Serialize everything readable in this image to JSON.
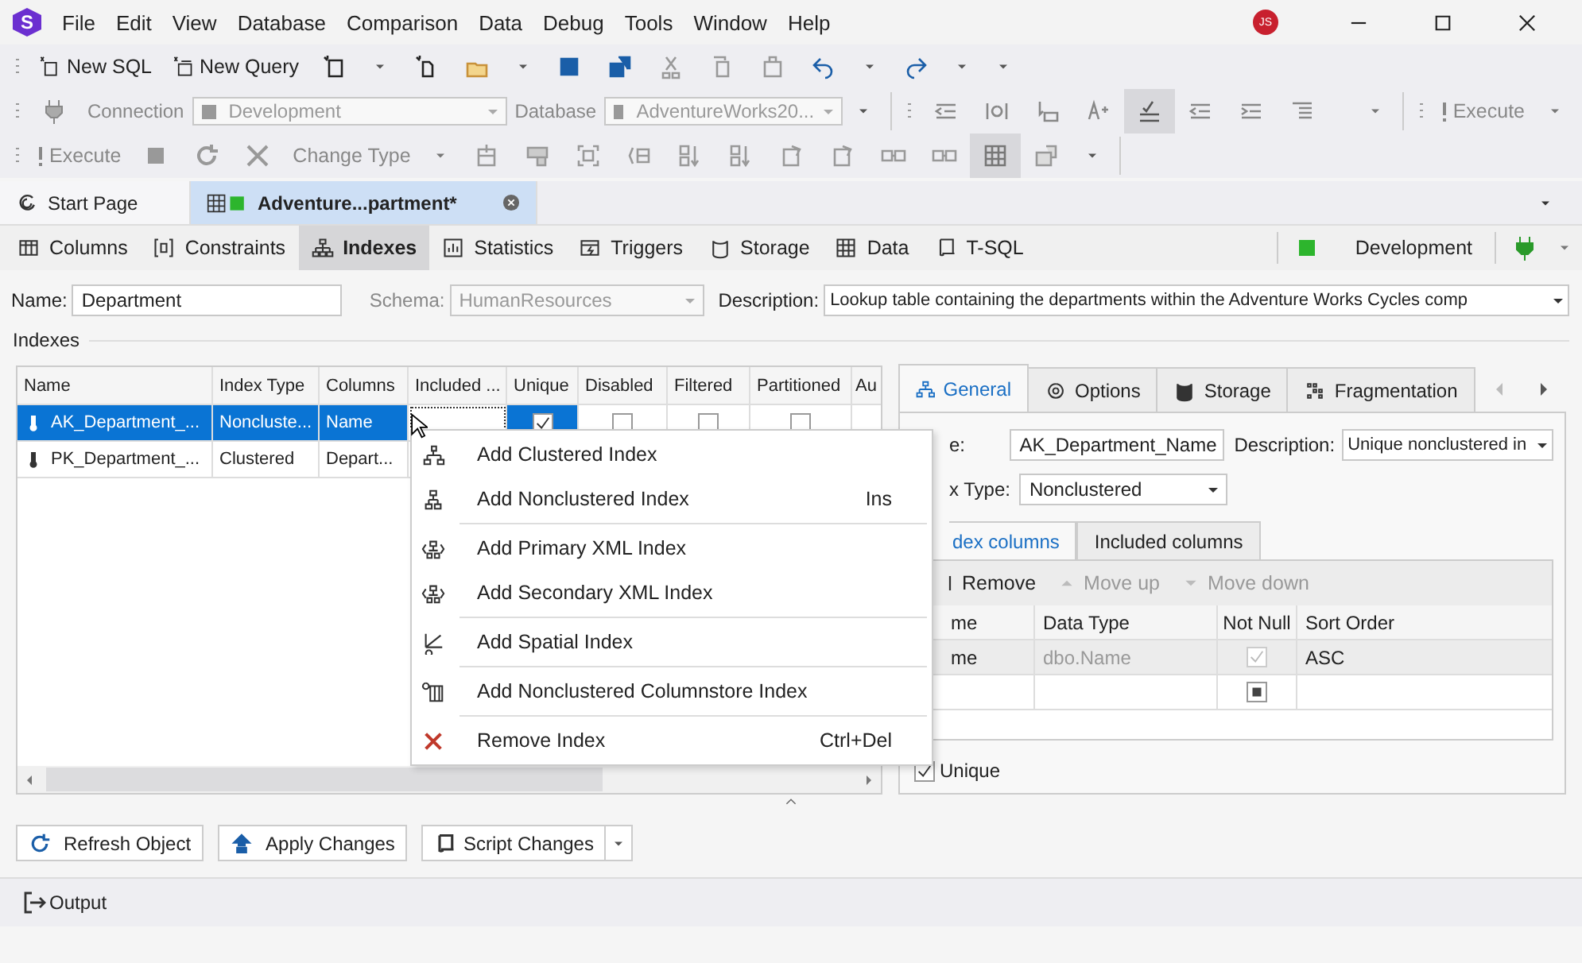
{
  "title_bar": {
    "logo": "S",
    "menu": [
      "File",
      "Edit",
      "View",
      "Database",
      "Comparison",
      "Data",
      "Debug",
      "Tools",
      "Window",
      "Help"
    ],
    "avatar": "JS"
  },
  "toolbar_main": {
    "new_sql": "New SQL",
    "new_query": "New Query"
  },
  "toolbar_connection": {
    "connection_label": "Connection",
    "connection": {
      "value": "Development",
      "disabled": true
    },
    "database_label": "Database",
    "database": {
      "value": "AdventureWorks20...",
      "disabled": true
    },
    "sql_toggle": {
      "on": true
    },
    "execute": {
      "label": "Execute",
      "disabled": true
    }
  },
  "toolbar_edit": {
    "execute": {
      "label": "Execute",
      "disabled": true
    },
    "change_type": {
      "label": "Change Type",
      "disabled": true
    },
    "grid_toggle": {
      "on": true
    }
  },
  "document_tabs": [
    {
      "kind": "start",
      "label": "Start Page",
      "selected": false
    },
    {
      "kind": "table",
      "label": "Adventure...partment*",
      "selected": true
    }
  ],
  "editor_tabs": [
    {
      "kind": "columns",
      "label": "Columns",
      "selected": false
    },
    {
      "kind": "constraints",
      "label": "Constraints",
      "selected": false
    },
    {
      "kind": "indexes",
      "label": "Indexes",
      "selected": true
    },
    {
      "kind": "statistics",
      "label": "Statistics",
      "selected": false
    },
    {
      "kind": "triggers",
      "label": "Triggers",
      "selected": false
    },
    {
      "kind": "storage",
      "label": "Storage",
      "selected": false
    },
    {
      "kind": "data",
      "label": "Data",
      "selected": false
    },
    {
      "kind": "tsql",
      "label": "T-SQL",
      "selected": false
    }
  ],
  "connection_status": {
    "label": "Development"
  },
  "properties": {
    "name_label": "Name:",
    "name": "Department",
    "schema_label": "Schema:",
    "schema": {
      "value": "HumanResources",
      "disabled": true
    },
    "description_label": "Description:",
    "description": "Lookup table containing the departments within the Adventure Works Cycles comp"
  },
  "indexes": {
    "title": "Indexes",
    "columns": [
      "Name",
      "Index Type",
      "Columns",
      "Included ...",
      "Unique",
      "Disabled",
      "Filtered",
      "Partitioned",
      "Au"
    ],
    "rows": [
      {
        "selected": true,
        "name": "AK_Department_...",
        "index_type": "Noncluste...",
        "columns": "Name",
        "flags": [
          {
            "checked": true
          },
          {
            "checked": false
          },
          {
            "checked": false
          },
          {
            "checked": false
          }
        ]
      },
      {
        "selected": false,
        "name": "PK_Department_...",
        "index_type": "Clustered",
        "columns": "Depart..."
      }
    ]
  },
  "context_menu": [
    {
      "kind": "clustered",
      "label": "Add Clustered Index",
      "separator_before": false
    },
    {
      "kind": "nonclustered",
      "label": "Add Nonclustered Index",
      "shortcut": "Ins",
      "separator_before": false
    },
    {
      "kind": "xml",
      "label": "Add Primary XML Index",
      "separator_before": true
    },
    {
      "kind": "xml",
      "label": "Add Secondary XML Index",
      "separator_before": false
    },
    {
      "kind": "spatial",
      "label": "Add Spatial Index",
      "separator_before": true
    },
    {
      "kind": "columnstore",
      "label": "Add Nonclustered Columnstore Index",
      "separator_before": true
    },
    {
      "kind": "remove",
      "label": "Remove Index",
      "shortcut": "Ctrl+Del",
      "separator_before": true
    }
  ],
  "index_properties": {
    "tabs": [
      {
        "kind": "general",
        "label": "General",
        "selected": true
      },
      {
        "kind": "options",
        "label": "Options",
        "selected": false
      },
      {
        "kind": "storage",
        "label": "Storage",
        "selected": false
      },
      {
        "kind": "fragmentation",
        "label": "Fragmentation",
        "selected": false
      }
    ],
    "name_label": "e:",
    "name": "AK_Department_Name",
    "description_label": "Description:",
    "description": "Unique nonclustered in",
    "type_label": "x Type:",
    "type": "Nonclustered",
    "column_tabs": [
      {
        "label": "dex columns",
        "selected": true
      },
      {
        "label": "Included columns",
        "selected": false
      }
    ],
    "actions": [
      {
        "kind": "remove",
        "label": "Remove",
        "disabled": false
      },
      {
        "kind": "up",
        "label": "Move up",
        "disabled": true
      },
      {
        "kind": "down",
        "label": "Move down",
        "disabled": true
      }
    ],
    "grid_columns": [
      "me",
      "Data Type",
      "Not Null",
      "Sort Order"
    ],
    "grid_rows": [
      {
        "selected": true,
        "name": "me",
        "data_type": "dbo.Name",
        "not_null": true,
        "not_null_indeterminate": false,
        "not_null_disabled": true,
        "sort_order": "ASC"
      },
      {
        "selected": false,
        "not_null": false,
        "not_null_indeterminate": true,
        "not_null_disabled": false
      }
    ],
    "unique": {
      "label": "Unique",
      "checked": true
    }
  },
  "buttons": [
    {
      "kind": "refresh",
      "label": "Refresh Object",
      "dropdown": false
    },
    {
      "kind": "apply",
      "label": "Apply Changes",
      "dropdown": false
    },
    {
      "kind": "script",
      "label": "Script Changes",
      "dropdown": true
    }
  ],
  "output": {
    "label": "Output"
  }
}
